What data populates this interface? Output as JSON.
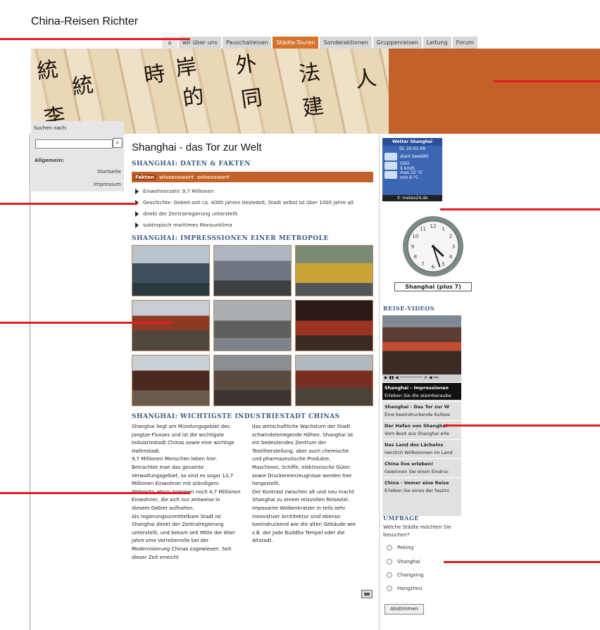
{
  "site": {
    "title": "China-Reisen Richter"
  },
  "nav": {
    "home_icon": "home-icon",
    "items": [
      "wir über uns",
      "Pauschalreisen",
      "Städte-Touren",
      "Sonderaktionen",
      "Gruppenreisen",
      "Leitung",
      "Forum"
    ],
    "active": "Städte-Touren"
  },
  "search": {
    "label": "Suchen nach:",
    "button_icon": "search-icon"
  },
  "sidebar": {
    "title": "Allgemein:",
    "links": [
      "Startseite",
      "Impressum"
    ]
  },
  "main": {
    "title": "Shanghai -  das Tor zur Welt",
    "section1": "SHANGHAI: DATEN & FAKTEN",
    "subtabs": [
      "Fakten",
      "wissenswert",
      "sehenswert"
    ],
    "facts": [
      "Einwohnerzahl: 9,7 Millionen",
      "Geschichte: Gebiet seit ca. 4000 Jahren besiedelt; Stadt selbst ist über 1000 Jahre alt",
      "direkt der Zentralregierung unterstellt",
      "subtropisch maritimes Monsunklima"
    ],
    "section2": "SHANGHAI: IMPRESSSIONEN EINER METROPOLE",
    "section3": "SHANGHAI: WICHTIGSTE INDUSTRIESTADT CHINAS",
    "article_left": [
      "Shanghai liegt am Mündungsgebiet des",
      "Jangtze-Flusses und ist die wichtigste",
      "Industriestadt Chinas sowie eine wichtige",
      "Hafenstadt.",
      "9,7 Millionen Menschen leben hier.",
      "Betrachtet man das gesamte",
      "Verwaltungsgebiet, so sind es sogar 13,7",
      "Millionen Einwohner mit ständigem",
      "Wohnsitz. Hinzu kommen noch 4,7 Millionen",
      "Einwohner, die sich nur zeitweise in",
      "diesem Gebiet aufhalten.",
      "Als regierungsunmittelbare Stadt ist",
      "Shanghai direkt der Zentralregierung",
      "unterstellt, und bekam seit Mitte der 80er",
      "Jahre eine Vorreiterrolle bei der",
      "Modernisierung Chinas zugewiesen. Seit",
      "dieser Zeit erreicht"
    ],
    "article_right": [
      "das wirtschaftliche Wachstum der Stadt",
      "schwindelerregende Höhen. Shanghai ist",
      "ein bedeutendes Zentrum der",
      "Textilherstellung, aber auch chemische",
      "und pharmazeutische Produkte,",
      "Maschinen, Schiffe, elektronische Güter",
      "sowie Druckereierzeugnisse werden hier",
      "hergestellt.",
      "Der Kontrast zwischen alt und neu macht",
      "Shanghai zu einem reizvollen Reiseziel.",
      "Imposante Wolkenkratzer in teils sehr",
      "innovativer Architektur sind ebenso",
      "beeindruckend wie die alten Gebäude wie",
      "z.B. der Jade Buddha Tempel oder die",
      "Altstadt."
    ],
    "print_icon": "print-icon"
  },
  "weather": {
    "title": "Wetter Shanghai",
    "date": "Di. 20.01.09",
    "rows": [
      "stark bewölkt",
      "OSO\n9 km/h",
      "max  12 °C\nmin    6 °C"
    ],
    "footer": "© meteo24.de"
  },
  "clock": {
    "label": "Shanghai (plus 7)",
    "hour": 4,
    "minute": 27
  },
  "videos": {
    "title": "REISE-VIDEOS",
    "controls": "▶ ▮▮ ◀ ───────── ✕ ◀ ══",
    "items": [
      {
        "title": "Shanghai - Impressionen",
        "desc": "Erleben Sie die atemberaube"
      },
      {
        "title": "Shanghai - Das Tor zur W",
        "desc": "Eine beeindruckende Kulisse"
      },
      {
        "title": "Der Hafen von Shanghai",
        "desc": "Vom Boot aus Shanghai erle"
      },
      {
        "title": "Das Land des Lächelns",
        "desc": "Herzlich Willkommen im Land"
      },
      {
        "title": "China live erleben!",
        "desc": "Gewinnen Sie einen Eindruc"
      },
      {
        "title": "China - Immer eine Reise",
        "desc": "Erleben Sie eines der faszini"
      }
    ]
  },
  "poll": {
    "title": "UMFRAGE",
    "question": "Welche Städte möchten Sie besuchen?",
    "options": [
      "Peking",
      "Shanghai",
      "Changxing",
      "Hangzhou"
    ],
    "button": "Abstimmen"
  },
  "colors": {
    "accent": "#c2622a",
    "heading": "#3b5a80",
    "marker": "#e31d24"
  }
}
